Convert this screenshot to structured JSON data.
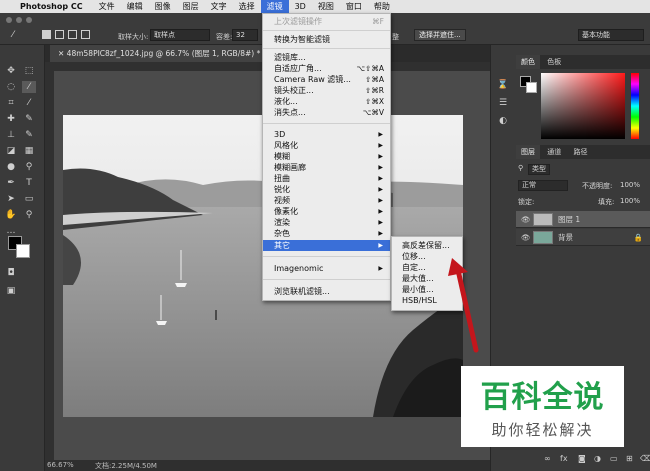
{
  "menubar": {
    "app": "Photoshop CC",
    "items": [
      "文件",
      "编辑",
      "图像",
      "图层",
      "文字",
      "选择",
      "滤镜",
      "3D",
      "视图",
      "窗口",
      "帮助"
    ],
    "active_index": 6
  },
  "options": {
    "sample_size_label": "取样大小:",
    "sample_size_value": "取样点",
    "tolerance_label": "容差:",
    "tolerance_value": "32",
    "btn_partial": "整",
    "select_mask_button": "选择并遮住...",
    "workspace": "基本功能"
  },
  "document": {
    "tab_title": "48m58PIC8zf_1024.jpg @ 66.7% (图层 1, RGB/8#) *",
    "zoom": "66.67%",
    "doc_info": "文档:2.25M/4.50M"
  },
  "filter_menu": {
    "last_filter": "上次滤镜操作",
    "last_filter_shortcut": "⌘F",
    "convert_smart": "转换为智能滤镜",
    "gallery": "滤镜库...",
    "adaptive_wide": "自适应广角...",
    "adaptive_wide_shortcut": "⌥⇧⌘A",
    "camera_raw": "Camera Raw 滤镜...",
    "camera_raw_shortcut": "⇧⌘A",
    "lens_correction": "镜头校正...",
    "lens_correction_shortcut": "⇧⌘R",
    "liquify": "液化...",
    "liquify_shortcut": "⇧⌘X",
    "vanishing_point": "消失点...",
    "vanishing_point_shortcut": "⌥⌘V",
    "groups": [
      "3D",
      "风格化",
      "模糊",
      "模糊画廊",
      "扭曲",
      "锐化",
      "视频",
      "像素化",
      "渲染",
      "杂色",
      "其它"
    ],
    "highlighted": "其它",
    "imagenomic": "Imagenomic",
    "browse_online": "浏览联机滤镜..."
  },
  "other_submenu": {
    "items": [
      "高反差保留...",
      "位移...",
      "自定...",
      "最大值...",
      "最小值...",
      "HSB/HSL"
    ]
  },
  "color_panel": {
    "tabs": [
      "颜色",
      "色板"
    ]
  },
  "layers_panel": {
    "tabs": [
      "图层",
      "通道",
      "路径"
    ],
    "kind_filter": "类型",
    "blend_mode": "正常",
    "opacity_label": "不透明度:",
    "opacity_value": "100%",
    "lock_label": "锁定:",
    "fill_label": "填充:",
    "fill_value": "100%",
    "layers": [
      {
        "name": "图层 1",
        "selected": true
      },
      {
        "name": "背景",
        "selected": false
      }
    ]
  },
  "watermark": {
    "title": "百科全说",
    "subtitle": "助你轻松解决"
  },
  "colors": {
    "menu_highlight": "#3a6fd8",
    "watermark_green": "#21a04b",
    "arrow_red": "#c4161c"
  }
}
